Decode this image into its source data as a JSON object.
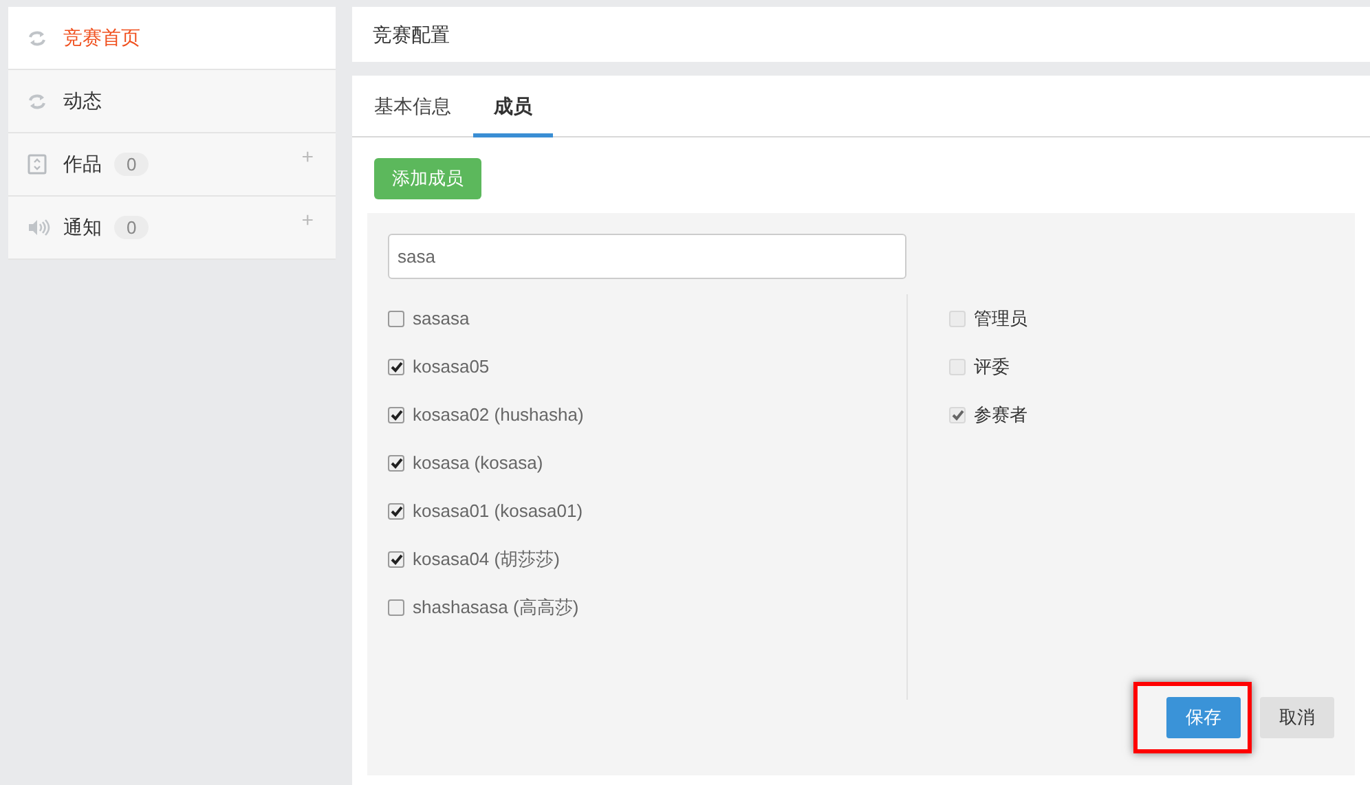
{
  "sidebar": {
    "items": [
      {
        "label": "竞赛首页",
        "kind": "refresh",
        "selected": true
      },
      {
        "label": "动态",
        "kind": "refresh",
        "selected": false
      },
      {
        "label": "作品",
        "kind": "expand",
        "selected": false,
        "count": "0",
        "plus": "+"
      },
      {
        "label": "通知",
        "kind": "speaker",
        "selected": false,
        "count": "0",
        "plus": "+"
      }
    ]
  },
  "header": {
    "title": "竞赛配置"
  },
  "tabs": [
    {
      "label": "基本信息",
      "selected": false
    },
    {
      "label": "成员",
      "selected": true
    }
  ],
  "add_button": "添加成员",
  "search": {
    "value": "sasa"
  },
  "members": [
    {
      "label": "sasasa",
      "checked": false
    },
    {
      "label": "kosasa05",
      "checked": true
    },
    {
      "label": "kosasa02 (hushasha)",
      "checked": true
    },
    {
      "label": "kosasa (kosasa)",
      "checked": true
    },
    {
      "label": "kosasa01 (kosasa01)",
      "checked": true
    },
    {
      "label": "kosasa04 (胡莎莎)",
      "checked": true
    },
    {
      "label": "shashasasa (高高莎)",
      "checked": false
    }
  ],
  "roles": [
    {
      "label": "管理员",
      "checked": false,
      "disabled": true
    },
    {
      "label": "评委",
      "checked": false,
      "disabled": true
    },
    {
      "label": "参赛者",
      "checked": true,
      "disabled": true
    }
  ],
  "buttons": [
    {
      "label": "保存",
      "kind": "primary",
      "highlighted": true
    },
    {
      "label": "取消",
      "kind": "secondary",
      "highlighted": false
    }
  ]
}
